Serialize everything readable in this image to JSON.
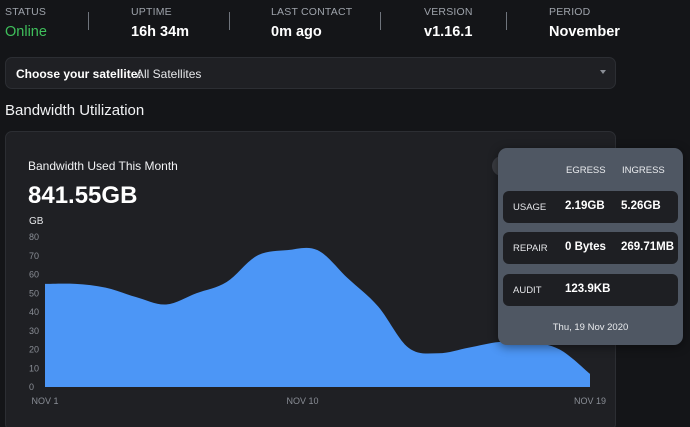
{
  "status_bar": [
    {
      "label": "STATUS",
      "value": "Online"
    },
    {
      "label": "UPTIME",
      "value": "16h 34m"
    },
    {
      "label": "LAST CONTACT",
      "value": "0m ago"
    },
    {
      "label": "VERSION",
      "value": "v1.16.1"
    },
    {
      "label": "PERIOD",
      "value": "November"
    }
  ],
  "satellite_selector": {
    "label": "Choose your satellite:",
    "value": "All Satellites"
  },
  "section_title": "Bandwidth Utilization",
  "card": {
    "title": "Bandwidth Used This Month",
    "total": "841.55GB",
    "unit": "GB"
  },
  "chart_data": {
    "type": "area",
    "ylabel": "GB",
    "ylim": [
      0,
      80
    ],
    "yticks": [
      0,
      10,
      20,
      30,
      40,
      50,
      60,
      70,
      80
    ],
    "xtick_labels": [
      "NOV 1",
      "NOV 10",
      "NOV 19"
    ],
    "x": [
      "Nov 1",
      "Nov 2",
      "Nov 3",
      "Nov 4",
      "Nov 5",
      "Nov 6",
      "Nov 7",
      "Nov 8",
      "Nov 9",
      "Nov 10",
      "Nov 11",
      "Nov 12",
      "Nov 13",
      "Nov 14",
      "Nov 15",
      "Nov 16",
      "Nov 17",
      "Nov 18",
      "Nov 19"
    ],
    "values": [
      55,
      55,
      53,
      48,
      44,
      50,
      56,
      70,
      73,
      73,
      58,
      43,
      21,
      18,
      21,
      24,
      24,
      20,
      7
    ],
    "fill_color": "#4c96f6",
    "grid": false
  },
  "tooltip": {
    "headers": [
      "EGRESS",
      "INGRESS"
    ],
    "rows": [
      {
        "label": "USAGE",
        "egress": "2.19GB",
        "ingress": "5.26GB"
      },
      {
        "label": "REPAIR",
        "egress": "0 Bytes",
        "ingress": "269.71MB"
      },
      {
        "label": "AUDIT",
        "egress": "123.9KB",
        "ingress": ""
      }
    ],
    "date": "Thu, 19 Nov 2020"
  },
  "colors": {
    "background": "#141518",
    "online": "#3fbf5b",
    "card": "#1f2024",
    "tooltip": "#4f5763",
    "area": "#4c96f6"
  }
}
